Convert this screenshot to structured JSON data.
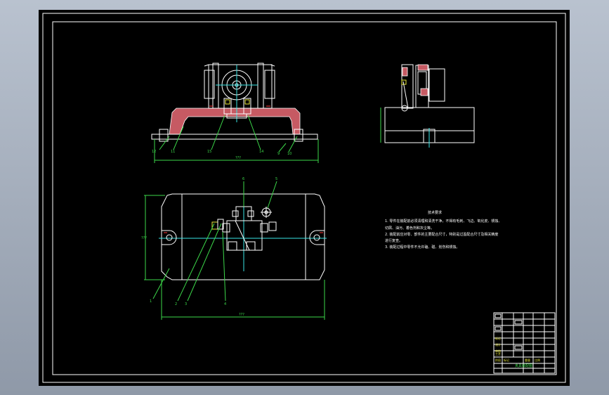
{
  "drawing": {
    "balloons": {
      "front": [
        "12",
        "11",
        "15",
        "14",
        "9",
        "10"
      ],
      "plan": [
        "6",
        "5",
        "1",
        "2",
        "3",
        "4"
      ]
    },
    "dims": {
      "front_width": "???",
      "plan_width": "???",
      "plan_height": "???"
    },
    "notes": {
      "title": "技术要求",
      "lines": [
        "1. 零件在装配前必须清理和清洗干净，不得有毛刺、飞边、氧化皮、锈蚀、",
        "   切屑、油污、着色剂和灰尘等。",
        "2. 装配前应对零、部件的主要配合尺寸，特别是过盈配合尺寸及相关精度",
        "   进行复查。",
        "3. 装配过程中零件不允许磕、碰、划伤和锈蚀。"
      ]
    },
    "title_block": {
      "row_labels": [
        "标记",
        "设计",
        "审核",
        "工艺"
      ],
      "bottom_labels": [
        "阶段",
        "标记",
        "重量",
        "比例"
      ],
      "part_name": "夹具装配图"
    }
  }
}
